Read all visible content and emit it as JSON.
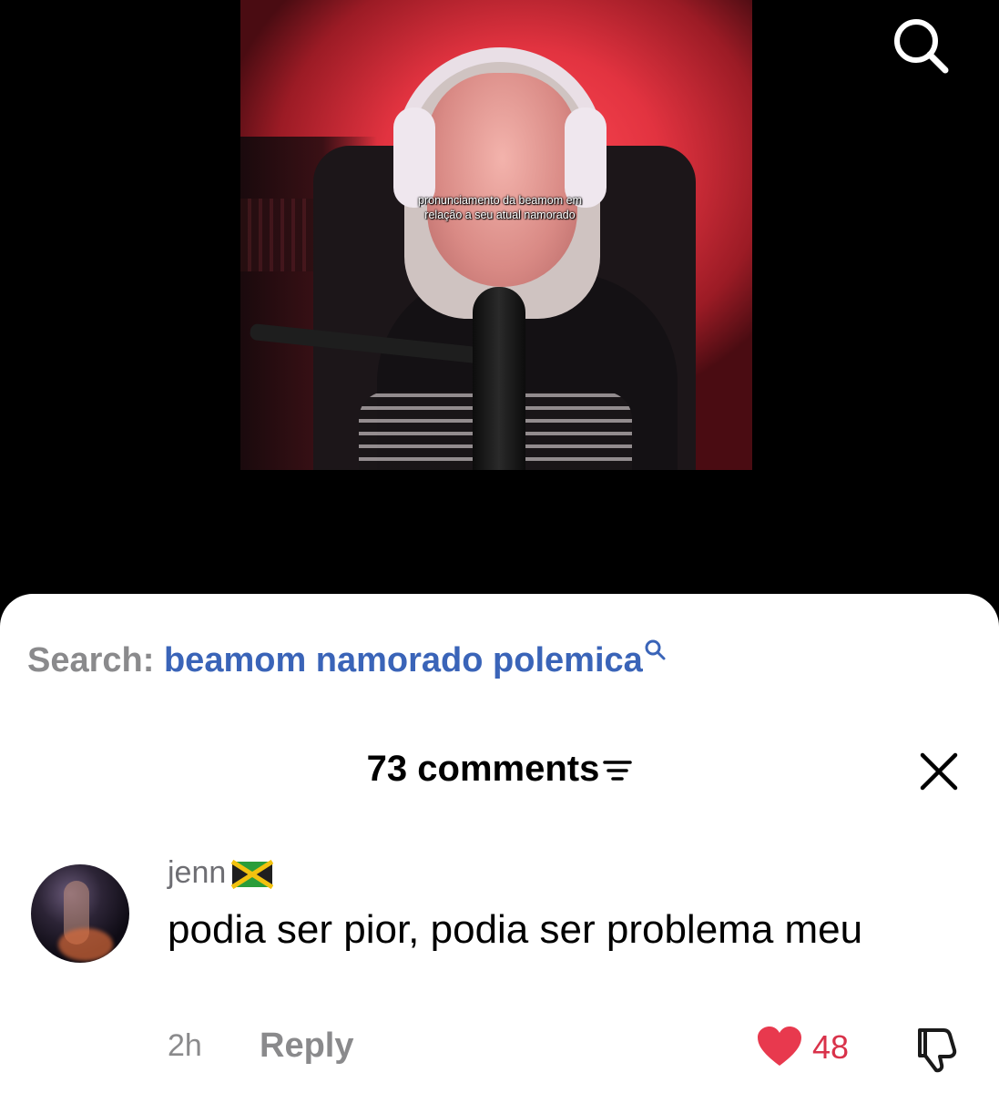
{
  "video": {
    "caption": "pronunciamento da beamom em relação a seu atual namorado",
    "search_icon": "search-icon"
  },
  "search_suggestion": {
    "label": "Search:",
    "query": "beamom namorado polemica",
    "icon": "search-icon"
  },
  "comments_panel": {
    "title": "73 comments",
    "filter_icon": "filter-icon",
    "close_icon": "close-icon"
  },
  "comment": {
    "username": "jenn",
    "flag": "jamaica-flag",
    "text": "podia ser pior, podia ser problema meu",
    "time": "2h",
    "reply_label": "Reply",
    "likes": "48",
    "like_color": "#e8394e",
    "dislike_icon": "thumbs-down-icon"
  }
}
